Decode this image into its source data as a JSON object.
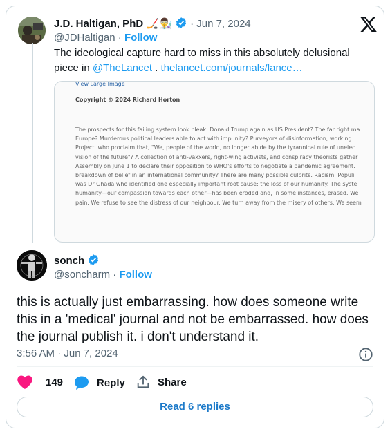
{
  "quoted_tweet": {
    "author_name": "J.D. Haltigan, PhD",
    "author_emoji": "🏒👨‍🔬",
    "handle": "@JDHaltigan",
    "separator": "·",
    "follow_label": "Follow",
    "date": "Jun 7, 2024",
    "text_line1": "The ideological capture hard to miss in this absolutely delusional",
    "text_line2_prefix": "piece in ",
    "mention": "@TheLancet",
    "text_line2_mid": " . ",
    "link": "thelancet.com/journals/lance…"
  },
  "embed": {
    "view_large_image": "View Large Image",
    "copyright": "Copyright © 2024 Richard Horton",
    "paragraph_lines": [
      "The prospects for this failing system look bleak. Donald Trump again as US President? The far right ma",
      "Europe? Murderous political leaders able to act with impunity? Purveyors of disinformation, working",
      "Project, who proclaim that, \"We, people of the world, no longer abide by the tyrannical rule of unelec",
      "vision of the future\"? A collection of anti-vaxxers, right-wing activists, and conspiracy theorists gather",
      "Assembly on June 1 to declare their opposition to WHO's efforts to negotiate a pandemic agreement.",
      "breakdown of belief in an international community? There are many possible culprits. Racism. Populi",
      "was Dr Ghada who identified one especially important root cause: the loss of our humanity. The syste",
      "humanity—our compassion towards each other—has been eroded and, in some instances, erased. We",
      "pain. We refuse to see the distress of our neighbour. We turn away from the misery of others. We seem"
    ]
  },
  "main_tweet": {
    "author_name": "sonch",
    "handle": "@soncharm",
    "separator": "·",
    "follow_label": "Follow",
    "text": "this is actually just embarrassing. how does someone write this in a 'medical' journal and not be embarrassed. how does the journal publish it. i don't understand it.",
    "timestamp": "3:56 AM · Jun 7, 2024"
  },
  "actions": {
    "likes": "149",
    "reply_label": "Reply",
    "share_label": "Share"
  },
  "read_replies_label": "Read 6 replies",
  "colors": {
    "accent": "#1d9bf0",
    "heart": "#f91880",
    "text": "#0f1419",
    "muted": "#536471"
  }
}
